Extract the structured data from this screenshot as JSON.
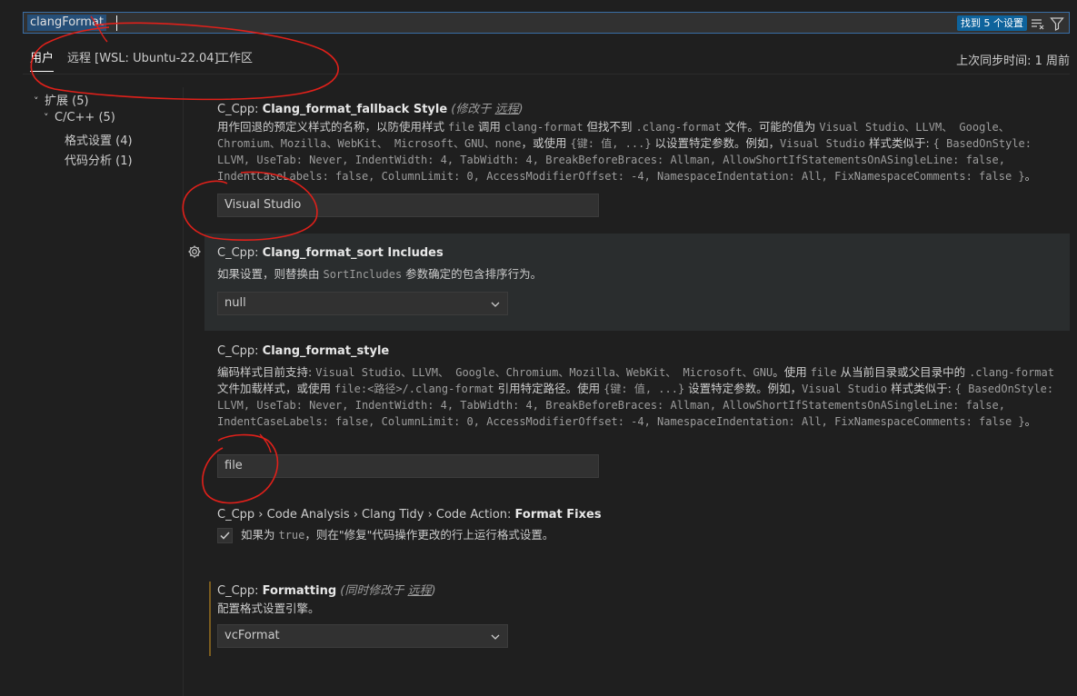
{
  "search": {
    "value": "clangFormat",
    "result_badge": "找到 5 个设置"
  },
  "icons": {
    "clear_filter": "clear-filter-icon",
    "filter": "filter-icon",
    "gear": "gear-icon",
    "chevron": "chevron-down-icon",
    "check": "check-icon"
  },
  "tabs": [
    {
      "label": "用户"
    },
    {
      "label": "远程 [WSL: Ubuntu-22.04]"
    },
    {
      "label": "工作区"
    }
  ],
  "last_sync": "上次同步时间: 1 周前",
  "tree": {
    "extensions": "扩展 (5)",
    "cpp": "C/C++ (5)",
    "formatting": "格式设置 (4)",
    "code_analysis": "代码分析 (1)"
  },
  "settings": {
    "fallback": {
      "prefix": "C_Cpp: ",
      "name": "Clang_format_fallback Style",
      "modified_prefix": "(修改于 ",
      "modified_link": "远程",
      "modified_suffix": ")",
      "d1": "用作回退的预定义样式的名称，以防使用样式 ",
      "d2": "file",
      "d3": " 调用 ",
      "d4": "clang-format",
      "d5": " 但找不到 ",
      "d6": ".clang-format",
      "d7": " 文件。可能的值为 ",
      "d8": "Visual Studio、LLVM、 Google、Chromium、Mozilla、WebKit、 Microsoft、GNU、none",
      "d9": "，或使用 ",
      "d10": "{键: 值, ...}",
      "d11": " 以设置特定参数。例如，",
      "d12": "Visual Studio",
      "d13": " 样式类似于: ",
      "d14": "{ BasedOnStyle: LLVM, UseTab: Never, IndentWidth: 4, TabWidth: 4, BreakBeforeBraces: Allman, AllowShortIfStatementsOnASingleLine: false, IndentCaseLabels: false, ColumnLimit: 0, AccessModifierOffset: -4, NamespaceIndentation: All, FixNamespaceComments: false }",
      "d15": "。",
      "value": "Visual Studio"
    },
    "sort_includes": {
      "prefix": "C_Cpp: ",
      "name": "Clang_format_sort Includes",
      "d1": "如果设置，则替换由 ",
      "d2": "SortIncludes",
      "d3": " 参数确定的包含排序行为。",
      "value": "null"
    },
    "style": {
      "prefix": "C_Cpp: ",
      "name": "Clang_format_style",
      "d1": "编码样式目前支持: ",
      "d2": "Visual Studio、LLVM、 Google、Chromium、Mozilla、WebKit、 Microsoft、GNU",
      "d3": "。使用 ",
      "d4": "file",
      "d5": " 从当前目录或父目录中的 ",
      "d6": ".clang-format",
      "d7": " 文件加载样式，或使用 ",
      "d8": "file:<路径>/.clang-format",
      "d9": " 引用特定路径。使用 ",
      "d10": "{键: 值, ...}",
      "d11": " 设置特定参数。例如，",
      "d12": "Visual Studio",
      "d13": " 样式类似于: ",
      "d14": "{ BasedOnStyle: LLVM, UseTab: Never, IndentWidth: 4, TabWidth: 4, BreakBeforeBraces: Allman, AllowShortIfStatementsOnASingleLine: false, IndentCaseLabels: false, ColumnLimit: 0, AccessModifierOffset: -4, NamespaceIndentation: All, FixNamespaceComments: false }",
      "d15": "。",
      "value": "file"
    },
    "format_fixes": {
      "prefix": "C_Cpp › Code Analysis › Clang Tidy › Code Action: ",
      "name": "Format Fixes",
      "d1": "如果为 ",
      "d2": "true",
      "d3": "，则在\"修复\"代码操作更改的行上运行格式设置。",
      "checked": true
    },
    "formatting": {
      "prefix": "C_Cpp: ",
      "name": "Formatting",
      "modified_prefix": "(同时修改于 ",
      "modified_link": "远程",
      "modified_suffix": ")",
      "desc": "配置格式设置引擎。",
      "value": "vcFormat"
    }
  },
  "colors": {
    "accent": "#0e639c",
    "annotation_ink": "#e0201a",
    "modified_bar": "#7a5c1f"
  }
}
